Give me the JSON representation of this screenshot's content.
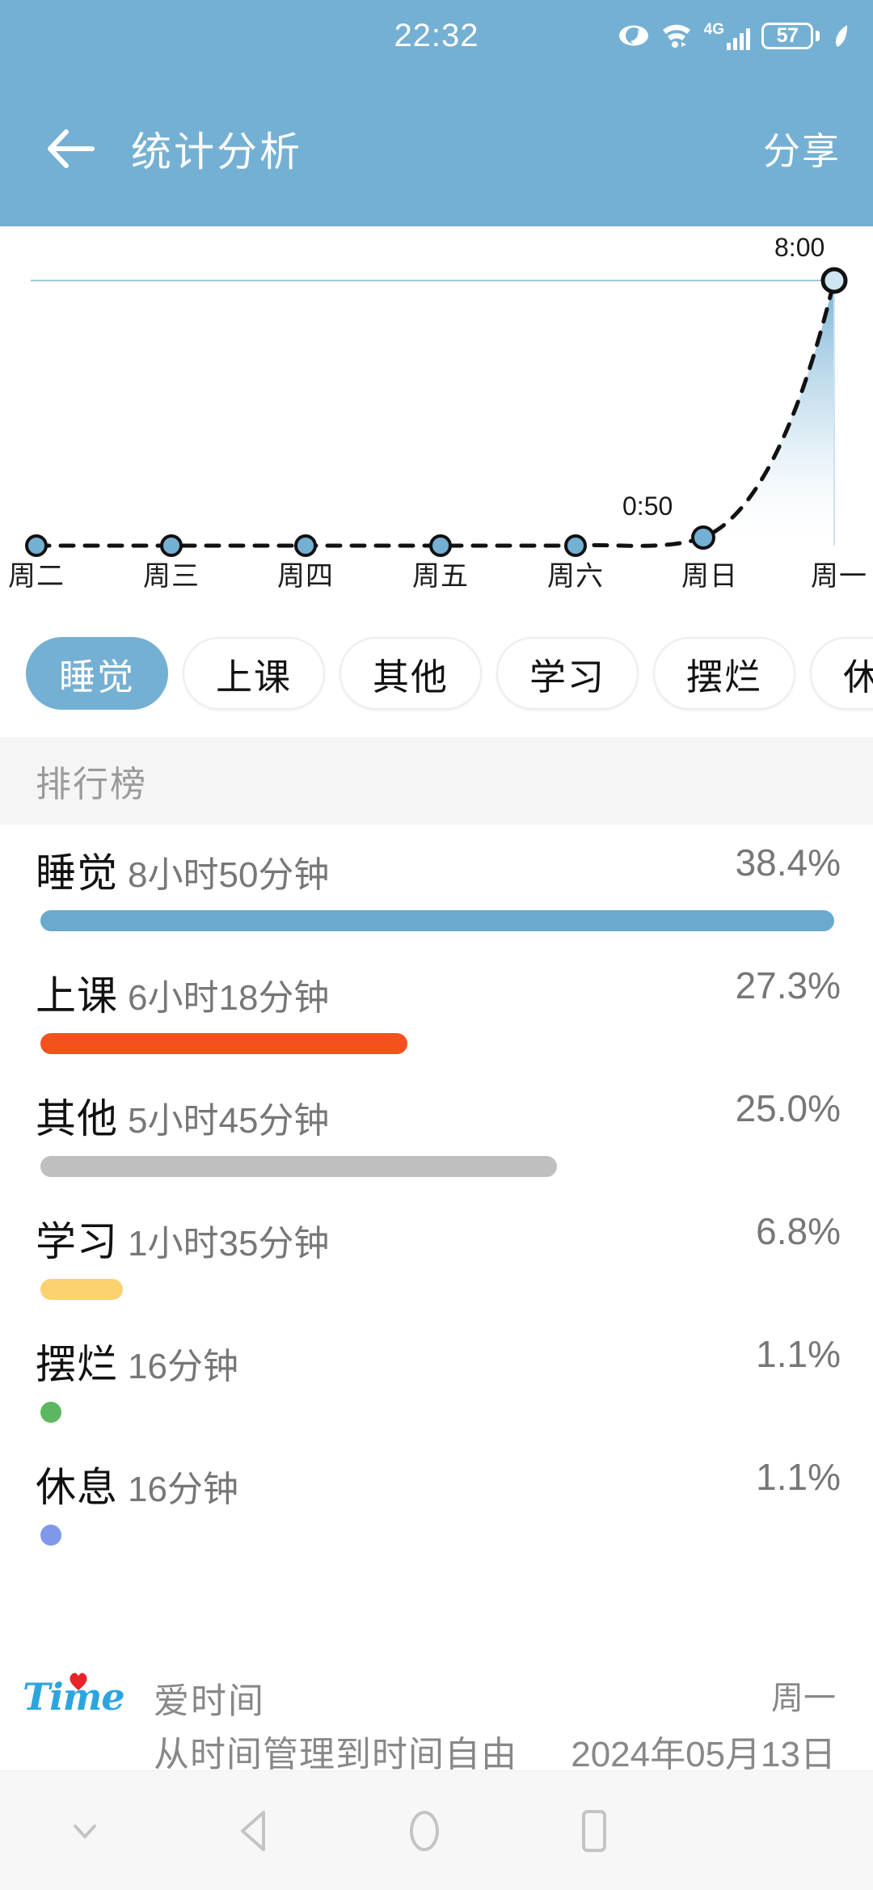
{
  "status_bar": {
    "time": "22:32",
    "battery_level": "57",
    "network_label": "4G",
    "icons": [
      "eye-comfort-icon",
      "wifi-icon",
      "cellular-signal-icon",
      "battery-icon",
      "power-save-leaf-icon"
    ]
  },
  "app_bar": {
    "back_label": "返回",
    "title": "统计分析",
    "share_label": "分享"
  },
  "chart_data": {
    "type": "line",
    "title": "",
    "xlabel": "",
    "ylabel": "",
    "categories": [
      "周二",
      "周三",
      "周四",
      "周五",
      "周六",
      "周日",
      "周一"
    ],
    "values": [
      0,
      0,
      0,
      0,
      0,
      0.833,
      8.0
    ],
    "value_labels": [
      "",
      "",
      "",
      "",
      "",
      "0:50",
      "8:00"
    ],
    "ylim": [
      0,
      8
    ],
    "grid": false,
    "legend": "none",
    "line_style": "dashed",
    "area_fill": true,
    "series": [
      {
        "name": "睡觉",
        "values": [
          0,
          0,
          0,
          0,
          0,
          0.833,
          8.0
        ]
      }
    ],
    "colors": {
      "line": "#1a1a1a",
      "point_fill": "#74b0d3",
      "area_top": "#74b0d3",
      "area_bottom": "#ffffff",
      "top_gridline": "#9fc8de"
    }
  },
  "chips": [
    {
      "label": "睡觉",
      "active": true
    },
    {
      "label": "上课",
      "active": false
    },
    {
      "label": "其他",
      "active": false
    },
    {
      "label": "学习",
      "active": false
    },
    {
      "label": "摆烂",
      "active": false
    },
    {
      "label": "休息",
      "active": false
    }
  ],
  "ranking": {
    "header": "排行榜",
    "rows": [
      {
        "name": "睡觉",
        "duration": "8小时50分钟",
        "percent": "38.4%",
        "bar_ratio": 1.0,
        "color": "#6ba9ce"
      },
      {
        "name": "上课",
        "duration": "6小时18分钟",
        "percent": "27.3%",
        "bar_ratio": 0.462,
        "color": "#f4511e"
      },
      {
        "name": "其他",
        "duration": "5小时45分钟",
        "percent": "25.0%",
        "bar_ratio": 0.651,
        "color": "#bfbfbf"
      },
      {
        "name": "学习",
        "duration": "1小时35分钟",
        "percent": "6.8%",
        "bar_ratio": 0.104,
        "color": "#fcd271"
      },
      {
        "name": "摆烂",
        "duration": "16分钟",
        "percent": "1.1%",
        "bar_ratio": 0.026,
        "color": "#5cb860"
      },
      {
        "name": "休息",
        "duration": "16分钟",
        "percent": "1.1%",
        "bar_ratio": 0.026,
        "color": "#8098ea"
      }
    ]
  },
  "footer": {
    "logo_text": "Time",
    "app_name": "爱时间",
    "slogan": "从时间管理到时间自由",
    "weekday": "周一",
    "date": "2024年05月13日"
  },
  "nav_bar": {
    "items": [
      {
        "name": "hide-keyboard-icon",
        "label": "隐藏"
      },
      {
        "name": "back-triangle-icon",
        "label": "返回"
      },
      {
        "name": "home-circle-icon",
        "label": "主页"
      },
      {
        "name": "recents-square-icon",
        "label": "最近任务"
      }
    ]
  }
}
